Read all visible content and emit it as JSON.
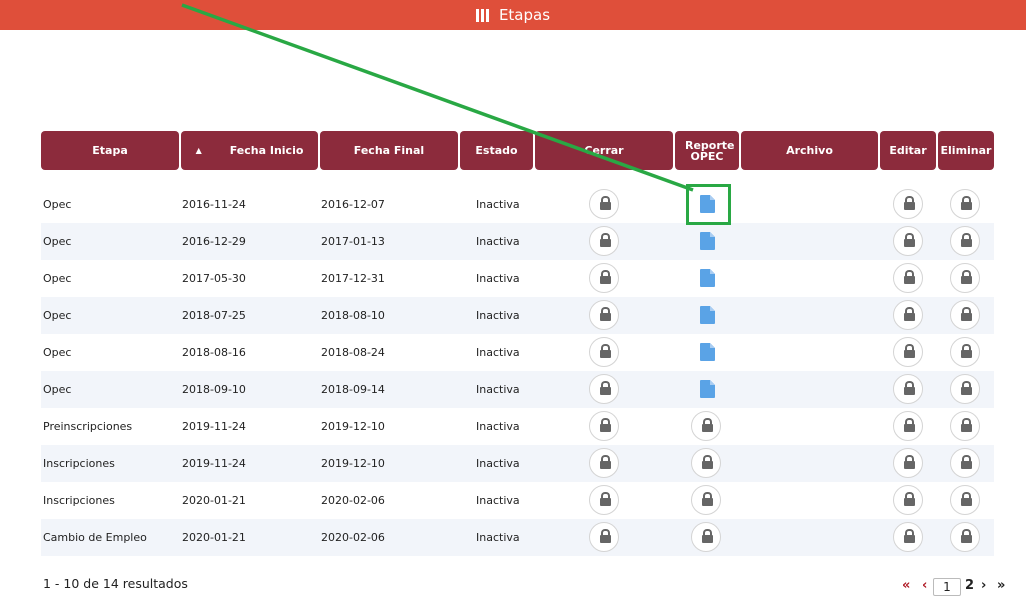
{
  "header": {
    "title": "Etapas"
  },
  "table": {
    "columns": [
      {
        "key": "etapa",
        "label": "Etapa"
      },
      {
        "key": "fecha_inicio",
        "label": "Fecha Inicio"
      },
      {
        "key": "fecha_final",
        "label": "Fecha Final"
      },
      {
        "key": "estado",
        "label": "Estado"
      },
      {
        "key": "cerrar",
        "label": "Cerrar"
      },
      {
        "key": "reporte",
        "label": "Reporte OPEC"
      },
      {
        "key": "archivo",
        "label": "Archivo"
      },
      {
        "key": "editar",
        "label": "Editar"
      },
      {
        "key": "eliminar",
        "label": "Eliminar"
      }
    ],
    "sort_indicator": "▲",
    "rows": [
      {
        "etapa": "Opec",
        "inicio": "2016-11-24",
        "final": "2016-12-07",
        "estado": "Inactiva",
        "reporte": "file"
      },
      {
        "etapa": "Opec",
        "inicio": "2016-12-29",
        "final": "2017-01-13",
        "estado": "Inactiva",
        "reporte": "file"
      },
      {
        "etapa": "Opec",
        "inicio": "2017-05-30",
        "final": "2017-12-31",
        "estado": "Inactiva",
        "reporte": "file"
      },
      {
        "etapa": "Opec",
        "inicio": "2018-07-25",
        "final": "2018-08-10",
        "estado": "Inactiva",
        "reporte": "file"
      },
      {
        "etapa": "Opec",
        "inicio": "2018-08-16",
        "final": "2018-08-24",
        "estado": "Inactiva",
        "reporte": "file"
      },
      {
        "etapa": "Opec",
        "inicio": "2018-09-10",
        "final": "2018-09-14",
        "estado": "Inactiva",
        "reporte": "file"
      },
      {
        "etapa": "Preinscripciones",
        "inicio": "2019-11-24",
        "final": "2019-12-10",
        "estado": "Inactiva",
        "reporte": "lock"
      },
      {
        "etapa": "Inscripciones",
        "inicio": "2019-11-24",
        "final": "2019-12-10",
        "estado": "Inactiva",
        "reporte": "lock"
      },
      {
        "etapa": "Inscripciones",
        "inicio": "2020-01-21",
        "final": "2020-02-06",
        "estado": "Inactiva",
        "reporte": "lock"
      },
      {
        "etapa": "Cambio de Empleo",
        "inicio": "2020-01-21",
        "final": "2020-02-06",
        "estado": "Inactiva",
        "reporte": "lock"
      }
    ]
  },
  "footer": {
    "results_text": "1 - 10 de 14 resultados",
    "pager": {
      "first": "«",
      "prev": "‹",
      "current_page": "1",
      "next_page": "2",
      "next": "›",
      "last": "»"
    }
  },
  "icons": {
    "lock": "lock-icon",
    "report": "file-icon",
    "header": "bars-icon"
  },
  "colors": {
    "topbar": "#df4f3a",
    "table_header": "#8c2b3c",
    "file_icon": "#5aa3e6",
    "annotation": "#29a844",
    "pager_red": "#b01d28"
  }
}
